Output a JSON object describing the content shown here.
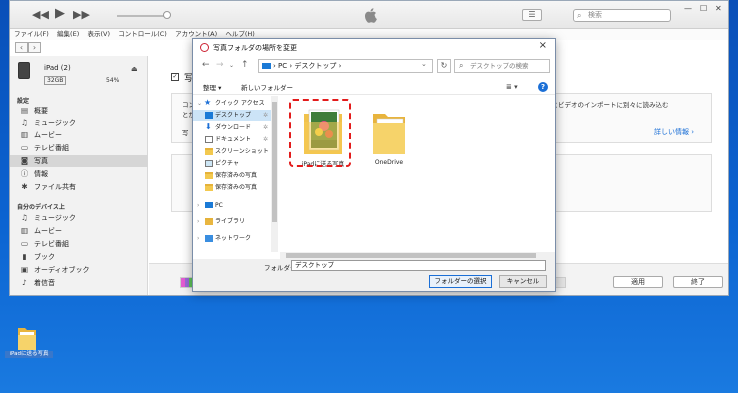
{
  "itunes": {
    "search_placeholder": "検索",
    "menu": [
      "ファイル(F)",
      "編集(E)",
      "表示(V)",
      "コントロール(C)",
      "アカウント(A)",
      "ヘルプ(H)"
    ],
    "device": {
      "name": "iPad (2)",
      "capacity": "32GB",
      "battery": "54%"
    },
    "settings_header": "設定",
    "settings_items": [
      {
        "label": "概要",
        "icon": "summary-icon"
      },
      {
        "label": "ミュージック",
        "icon": "music-icon"
      },
      {
        "label": "ムービー",
        "icon": "movie-icon"
      },
      {
        "label": "テレビ番組",
        "icon": "tv-icon"
      },
      {
        "label": "写真",
        "icon": "camera-icon"
      },
      {
        "label": "情報",
        "icon": "info-icon"
      },
      {
        "label": "ファイル共有",
        "icon": "apps-icon"
      }
    ],
    "ondevice_header": "自分のデバイス上",
    "ondevice_items": [
      {
        "label": "ミュージック",
        "icon": "music-icon"
      },
      {
        "label": "ムービー",
        "icon": "movie-icon"
      },
      {
        "label": "テレビ番組",
        "icon": "tv-icon"
      },
      {
        "label": "ブック",
        "icon": "book-icon"
      },
      {
        "label": "オーディオブック",
        "icon": "audiobook-icon"
      },
      {
        "label": "着信音",
        "icon": "bell-icon"
      }
    ],
    "content": {
      "title": "写",
      "box_line1": "コン",
      "box_line2": "とが",
      "box_line3": "写",
      "box_right": "ダ画像とビデオのインポートに別々に読み込む",
      "more_info": "詳しい情報 ›",
      "apply": "適用",
      "done": "終了"
    },
    "capacity_colors": [
      "#e45cd3",
      "#9b6ad8",
      "#5fc65a",
      "#f2b233"
    ]
  },
  "dialog": {
    "title": "写真フォルダの場所を変更",
    "path": [
      "PC",
      "デスクトップ"
    ],
    "search_placeholder": "デスクトップの検索",
    "organize": "整理 ▾",
    "new_folder": "新しいフォルダー",
    "nav_items": [
      {
        "label": "クイック アクセス",
        "type": "star",
        "arrow": "⌄"
      },
      {
        "label": "デスクトップ",
        "type": "desktop",
        "pin": "✲",
        "selected": true
      },
      {
        "label": "ダウンロード",
        "type": "download",
        "pin": "✲"
      },
      {
        "label": "ドキュメント",
        "type": "doc",
        "pin": "✲"
      },
      {
        "label": "スクリーンショット",
        "type": "folder"
      },
      {
        "label": "ピクチャ",
        "type": "pic"
      },
      {
        "label": "保存済みの写真",
        "type": "folder"
      },
      {
        "label": "保存済みの写真",
        "type": "folder"
      },
      {
        "label": "PC",
        "type": "pc",
        "arrow": "›"
      },
      {
        "label": "ライブラリ",
        "type": "lib",
        "arrow": "›"
      },
      {
        "label": "ネットワーク",
        "type": "net",
        "arrow": "›"
      }
    ],
    "files": [
      {
        "label": "iPadに送る写真"
      },
      {
        "label": "OneDrive"
      }
    ],
    "folder_label": "フォルダー:",
    "folder_value": "デスクトップ",
    "select_button": "フォルダーの選択",
    "cancel_button": "キャンセル"
  },
  "desktop": {
    "icon_label": "iPadに送る写真"
  }
}
